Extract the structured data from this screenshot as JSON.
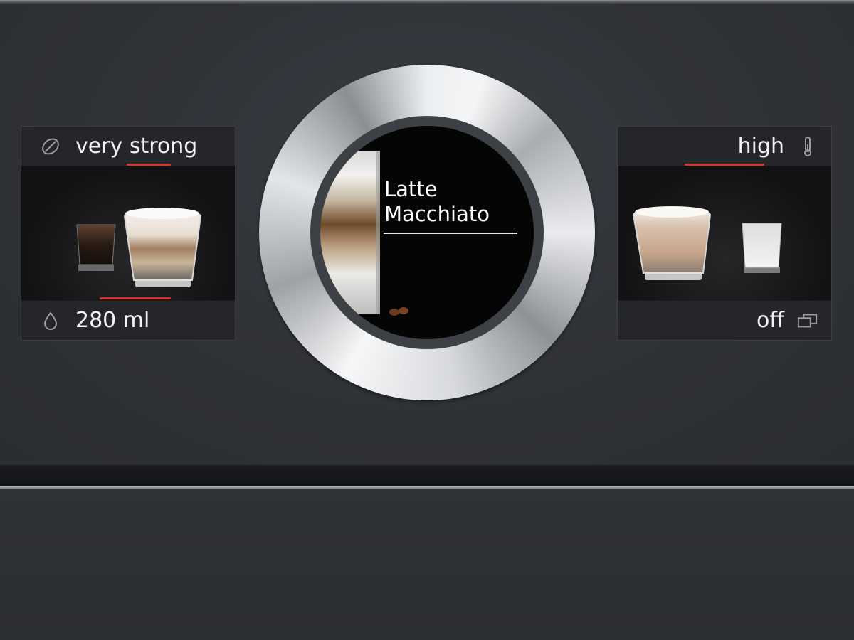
{
  "left_panel": {
    "strength": {
      "icon": "coffee-bean-icon",
      "label": "very strong"
    },
    "volume": {
      "icon": "water-drop-icon",
      "label": "280 ml"
    }
  },
  "right_panel": {
    "temperature": {
      "icon": "thermometer-icon",
      "label": "high"
    },
    "double_cup": {
      "icon": "double-cup-icon",
      "label": "off"
    }
  },
  "center_display": {
    "drink_name_line1": "Latte",
    "drink_name_line2": "Macchiato"
  },
  "colors": {
    "accent_red": "#d6342c",
    "panel_dark": "#2c2f33",
    "display_black": "#050505"
  }
}
